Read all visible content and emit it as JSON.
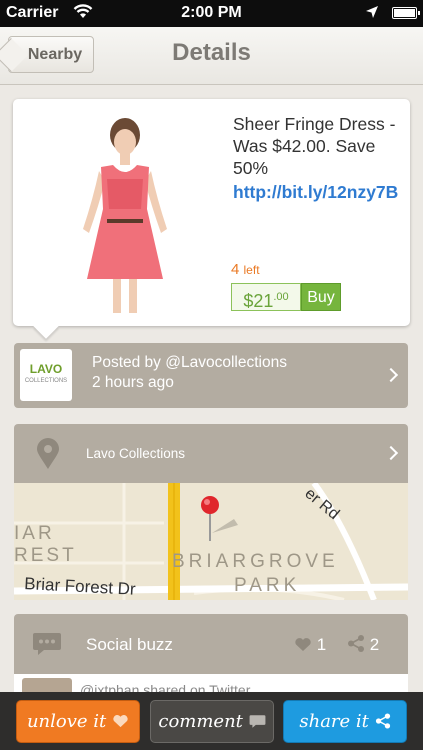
{
  "status": {
    "carrier": "Carrier",
    "time": "2:00 PM"
  },
  "nav": {
    "back_label": "Nearby",
    "title": "Details"
  },
  "product": {
    "title": "Sheer Fringe Dress - Was $42.00. Save 50%",
    "link": "http://bit.ly/12nzy7B",
    "left_count": "4",
    "left_label": "left",
    "price_dollar": "$",
    "price_whole": "21",
    "price_cents": ".00",
    "buy_label": "Buy"
  },
  "poster": {
    "logo_text": "LAVO",
    "logo_sub": "COLLECTIONS",
    "posted_by": "Posted by @Lavocollections",
    "time_ago": "2 hours ago"
  },
  "location": {
    "name": "Lavo Collections",
    "map_labels": [
      "BRIARGROVE",
      "PARK",
      "Briar Forest Dr",
      "er Rd",
      "IAR",
      "REST"
    ]
  },
  "social": {
    "label": "Social buzz",
    "hearts": "1",
    "shares": "2",
    "feed_text": "@ixtphan shared on Twitter"
  },
  "actions": {
    "unlove": "unlove it",
    "comment": "comment",
    "share": "share it"
  },
  "colors": {
    "accent_orange": "#f07a22",
    "accent_blue": "#1e9be0",
    "buy_green": "#76b53d",
    "link_blue": "#2f7bd1"
  }
}
